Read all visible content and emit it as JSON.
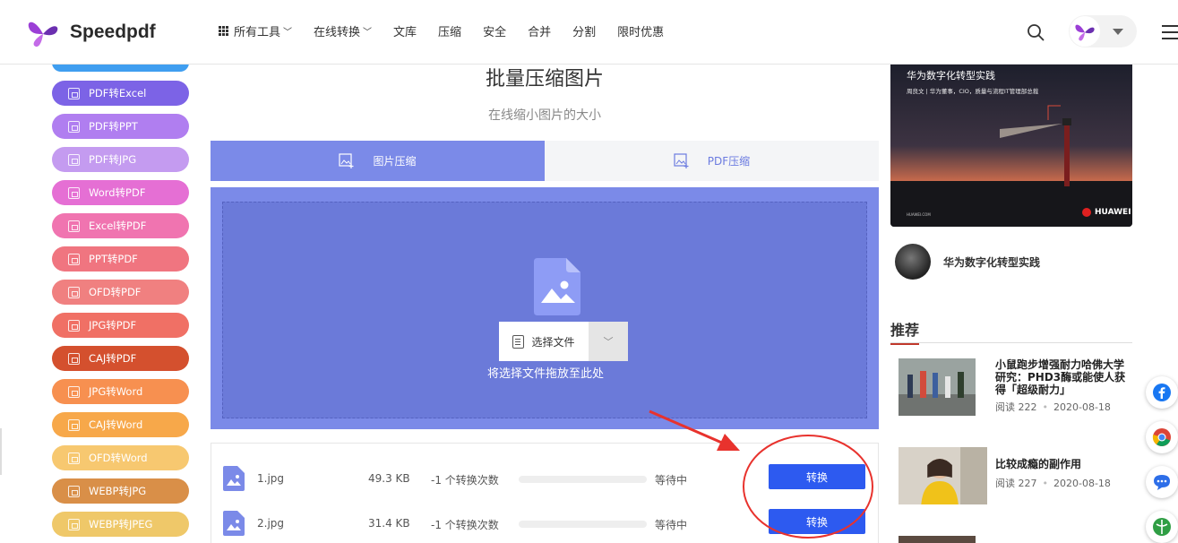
{
  "header": {
    "logo_text": "Speedpdf",
    "nav": [
      {
        "label": "所有工具",
        "has_dropdown": true,
        "icon": "grid-icon"
      },
      {
        "label": "在线转换",
        "has_dropdown": true
      },
      {
        "label": "文库"
      },
      {
        "label": "压缩"
      },
      {
        "label": "安全"
      },
      {
        "label": "合并"
      },
      {
        "label": "分割"
      },
      {
        "label": "限时优惠"
      }
    ]
  },
  "sidebar": {
    "items": [
      {
        "label": "",
        "color": "#3f9ef0"
      },
      {
        "label": "PDF转Excel",
        "color": "#7c63e6"
      },
      {
        "label": "PDF转PPT",
        "color": "#b07ef0"
      },
      {
        "label": "PDF转JPG",
        "color": "#c49bf0"
      },
      {
        "label": "Word转PDF",
        "color": "#e56fd4"
      },
      {
        "label": "Excel转PDF",
        "color": "#f074b0"
      },
      {
        "label": "PPT转PDF",
        "color": "#f07580"
      },
      {
        "label": "OFD转PDF",
        "color": "#f08080"
      },
      {
        "label": "JPG转PDF",
        "color": "#f07065"
      },
      {
        "label": "CAJ转PDF",
        "color": "#d4502e"
      },
      {
        "label": "JPG转Word",
        "color": "#f79050"
      },
      {
        "label": "CAJ转Word",
        "color": "#f7a84a"
      },
      {
        "label": "OFD转Word",
        "color": "#f7c870"
      },
      {
        "label": "WEBP转JPG",
        "color": "#d98f48"
      },
      {
        "label": "WEBP转JPEG",
        "color": "#efc869"
      }
    ]
  },
  "main": {
    "title": "批量压缩图片",
    "subtitle": "在线缩小图片的大小",
    "tabs": [
      {
        "label": "图片压缩",
        "active": true
      },
      {
        "label": "PDF压缩",
        "active": false
      }
    ],
    "choose_label": "选择文件",
    "drop_hint": "将选择文件拖放至此处",
    "files": [
      {
        "name": "1.jpg",
        "size": "49.3 KB",
        "count": "-1 个转换次数",
        "status": "等待中",
        "button": "转换",
        "progress": 0
      },
      {
        "name": "2.jpg",
        "size": "31.4 KB",
        "count": "-1 个转换次数",
        "status": "等待中",
        "button": "转换",
        "progress": 0
      }
    ]
  },
  "right": {
    "promo": {
      "title": "华为数字化转型实践",
      "sub": "周良文 | 华为董事，CIO，质量与流程IT管理部总裁",
      "brand": "HUAWEI",
      "small": "HUAWEI.COM"
    },
    "author_name": "华为数字化转型实践",
    "recommend_title": "推荐",
    "articles": [
      {
        "title": "小鼠跑步增强耐力哈佛大学研究：PHD3酶或能使人获得「超级耐力」",
        "reads": "阅读 222",
        "date": "2020-08-18"
      },
      {
        "title": "比较成瘾的副作用",
        "reads": "阅读 227",
        "date": "2020-08-18"
      },
      {
        "title": "",
        "reads": "",
        "date": ""
      }
    ]
  },
  "floating": [
    "facebook-icon",
    "chrome-icon",
    "chat-icon",
    "share-icon"
  ],
  "colors": {
    "accent": "#7b8ae8",
    "button": "#2d5af0",
    "annotation": "#e8322d"
  }
}
